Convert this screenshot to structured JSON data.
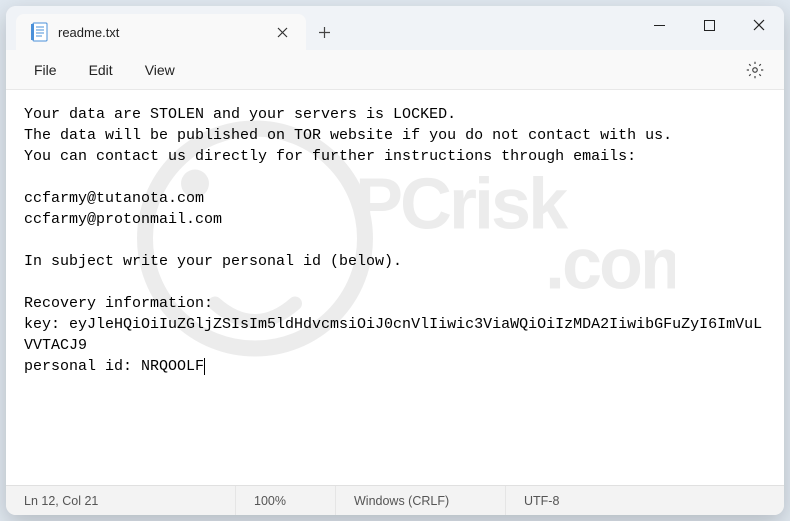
{
  "window": {
    "tab_title": "readme.txt"
  },
  "menu": {
    "file": "File",
    "edit": "Edit",
    "view": "View"
  },
  "content": {
    "line1": "Your data are STOLEN and your servers is LOCKED.",
    "line2": "The data will be published on TOR website if you do not contact with us.",
    "line3": "You can contact us directly for further instructions through emails:",
    "blank1": "",
    "email1": "ccfarmy@tutanota.com",
    "email2": "ccfarmy@protonmail.com",
    "blank2": "",
    "subject_line": "In subject write your personal id (below).",
    "blank3": "",
    "recovery_header": "Recovery information:",
    "key_label": "key: eyJleHQiOiIuZGljZSIsIm5ldHdvcmsiOiJ0cnVlIiwic3ViaWQiOiIzMDA2IiwibGFuZyI6ImVuLVVTACJ9",
    "personal_id": "personal id: NRQOOLF"
  },
  "status": {
    "position": "Ln 12, Col 21",
    "zoom": "100%",
    "line_ending": "Windows (CRLF)",
    "encoding": "UTF-8"
  }
}
